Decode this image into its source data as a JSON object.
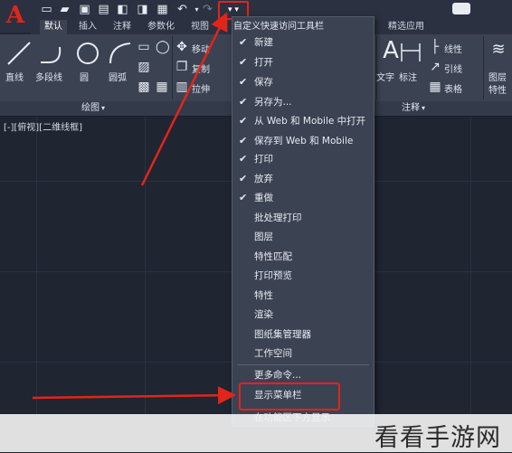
{
  "ribbon": {
    "tabs": [
      "默认",
      "插入",
      "注释",
      "参数化",
      "视图",
      "精选应用"
    ],
    "draw_tools": [
      "直线",
      "多段线",
      "圆",
      "圆弧"
    ],
    "modify_tools": [
      "移动",
      "复制",
      "拉伸"
    ],
    "annotation_tools": [
      "文字",
      "标注"
    ],
    "annotation_side": [
      "线性",
      "引线",
      "表格"
    ],
    "layers_label": "图层",
    "props_label": "特性",
    "panel_draw": "绘图",
    "panel_annotation": "注释"
  },
  "viewport": {
    "label": "[-][俯视][二维线框]"
  },
  "menu": {
    "title": "自定义快速访问工具栏",
    "items": [
      {
        "label": "新建",
        "checked": true
      },
      {
        "label": "打开",
        "checked": true
      },
      {
        "label": "保存",
        "checked": true
      },
      {
        "label": "另存为...",
        "checked": true
      },
      {
        "label": "从 Web 和 Mobile 中打开",
        "checked": true
      },
      {
        "label": "保存到 Web 和 Mobile",
        "checked": true
      },
      {
        "label": "打印",
        "checked": true
      },
      {
        "label": "放弃",
        "checked": true
      },
      {
        "label": "重做",
        "checked": true
      },
      {
        "label": "批处理打印",
        "checked": false
      },
      {
        "label": "图层",
        "checked": false
      },
      {
        "label": "特性匹配",
        "checked": false
      },
      {
        "label": "打印预览",
        "checked": false
      },
      {
        "label": "特性",
        "checked": false
      },
      {
        "label": "渲染",
        "checked": false
      },
      {
        "label": "图纸集管理器",
        "checked": false
      },
      {
        "label": "工作空间",
        "checked": false
      },
      {
        "label": "更多命令...",
        "checked": false
      },
      {
        "label": "显示菜单栏",
        "checked": false
      },
      {
        "label": "在功能区下方显示",
        "checked": false
      }
    ]
  },
  "watermark": "看看手游网",
  "colors": {
    "highlight": "#e3241b",
    "app_logo": "#e0261b",
    "menu_bg": "#3b4252"
  }
}
